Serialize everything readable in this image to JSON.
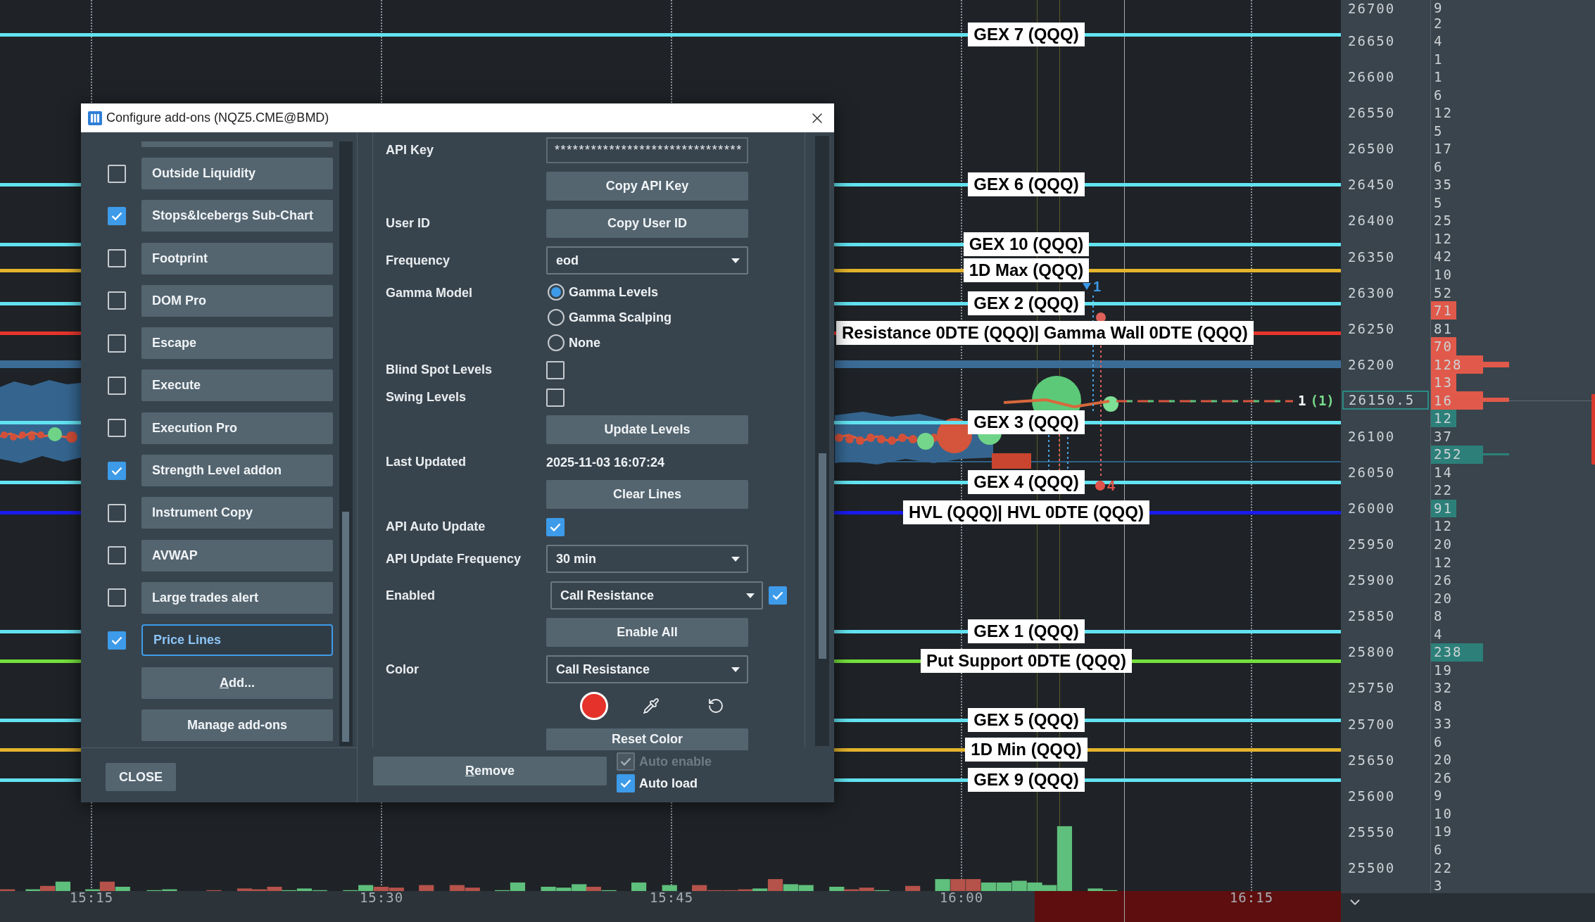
{
  "chart": {
    "levels": [
      {
        "label": "GEX 7 (QQQ)",
        "color": "#62e3f1"
      },
      {
        "label": "GEX 6 (QQQ)",
        "color": "#62e3f1"
      },
      {
        "label": "GEX 10 (QQQ)",
        "color": "#62e3f1"
      },
      {
        "label": "1D Max (QQQ)",
        "color": "#e4b42c"
      },
      {
        "label": "GEX 2 (QQQ)",
        "color": "#62e3f1"
      },
      {
        "label": "Resistance 0DTE (QQQ)| Gamma Wall 0DTE (QQQ)",
        "color": "#e8352c"
      },
      {
        "label": "GEX 3 (QQQ)",
        "color": "#62e3f1"
      },
      {
        "label": "GEX 4 (QQQ)",
        "color": "#62e3f1"
      },
      {
        "label": "HVL (QQQ)| HVL 0DTE (QQQ)",
        "color": "#1b1bf0"
      },
      {
        "label": "GEX 1 (QQQ)",
        "color": "#62e3f1"
      },
      {
        "label": "Put Support 0DTE (QQQ)",
        "color": "#74e03c"
      },
      {
        "label": "GEX 5 (QQQ)",
        "color": "#62e3f1"
      },
      {
        "label": "1D Min (QQQ)",
        "color": "#e4b42c"
      },
      {
        "label": "GEX 9 (QQQ)",
        "color": "#62e3f1"
      }
    ],
    "order_markers": [
      {
        "kind": "arrow",
        "text": "1",
        "color": "#3b9ae8"
      },
      {
        "kind": "dot",
        "text": "4",
        "color": "#e0524a"
      }
    ],
    "position_marker": {
      "count": "1",
      "detail": "(1)"
    },
    "time_axis": [
      "15:15",
      "15:30",
      "15:45",
      "16:00",
      "16:15"
    ]
  },
  "price_axis": {
    "ticks": [
      {
        "kind": "tick",
        "price": "26700"
      },
      {
        "kind": "tick",
        "price": "26650"
      },
      {
        "kind": "tick",
        "price": "26600"
      },
      {
        "kind": "tick",
        "price": "26550"
      },
      {
        "kind": "tick",
        "price": "26500"
      },
      {
        "kind": "tick",
        "price": "26450"
      },
      {
        "kind": "tick",
        "price": "26400"
      },
      {
        "kind": "tick",
        "price": "26350"
      },
      {
        "kind": "tick",
        "price": "26300"
      },
      {
        "kind": "tick",
        "price": "26250"
      },
      {
        "kind": "tick",
        "price": "26200"
      },
      {
        "kind": "current",
        "price": "26150.5"
      },
      {
        "kind": "tick",
        "price": "26100"
      },
      {
        "kind": "tick",
        "price": "26050"
      },
      {
        "kind": "tick",
        "price": "26000"
      },
      {
        "kind": "tick",
        "price": "25950"
      },
      {
        "kind": "tick",
        "price": "25900"
      },
      {
        "kind": "tick",
        "price": "25850"
      },
      {
        "kind": "tick",
        "price": "25800"
      },
      {
        "kind": "tick",
        "price": "25750"
      },
      {
        "kind": "tick",
        "price": "25700"
      },
      {
        "kind": "tick",
        "price": "25650"
      },
      {
        "kind": "tick",
        "price": "25600"
      },
      {
        "kind": "tick",
        "price": "25550"
      },
      {
        "kind": "tick",
        "price": "25500"
      }
    ],
    "volumes": [
      "9",
      "2",
      "4",
      "1",
      "1",
      "6",
      "12",
      "5",
      "17",
      "6",
      "35",
      "5",
      "25",
      "12",
      "42",
      "10",
      "52",
      "71",
      "81",
      "70",
      "128",
      "13",
      "16",
      "12",
      "37",
      "252",
      "14",
      "22",
      "91",
      "12",
      "20",
      "12",
      "26",
      "20",
      "8",
      "4",
      "238",
      "19",
      "32",
      "8",
      "33",
      "6",
      "20",
      "26",
      "9",
      "10",
      "19",
      "6",
      "22",
      "3"
    ]
  },
  "dialog": {
    "title": "Configure add-ons (NQZ5.CME@BMD)",
    "addons": [
      {
        "name": "Outside Liquidity",
        "checked": false,
        "selected": false
      },
      {
        "name": "Stops&Icebergs Sub-Chart",
        "checked": true,
        "selected": false
      },
      {
        "name": "Footprint",
        "checked": false,
        "selected": false
      },
      {
        "name": "DOM Pro",
        "checked": false,
        "selected": false
      },
      {
        "name": "Escape",
        "checked": false,
        "selected": false
      },
      {
        "name": "Execute",
        "checked": false,
        "selected": false
      },
      {
        "name": "Execution Pro",
        "checked": false,
        "selected": false
      },
      {
        "name": "Strength Level addon",
        "checked": true,
        "selected": false
      },
      {
        "name": "Instrument Copy",
        "checked": false,
        "selected": false
      },
      {
        "name": "AVWAP",
        "checked": false,
        "selected": false
      },
      {
        "name": "Large trades alert",
        "checked": false,
        "selected": false
      },
      {
        "name": "Price Lines",
        "checked": true,
        "selected": true
      }
    ],
    "addon_actions": [
      {
        "label": "Add...",
        "mnemonic": true
      },
      {
        "label": "Manage add-ons",
        "mnemonic": false
      }
    ],
    "close_button": "CLOSE",
    "settings": [
      {
        "kind": "password",
        "label": "API Key",
        "value": "*******************************"
      },
      {
        "kind": "button",
        "button": "Copy API Key"
      },
      {
        "kind": "button",
        "label": "User ID",
        "button": "Copy User ID"
      },
      {
        "kind": "dropdown",
        "label": "Frequency",
        "value": "eod"
      },
      {
        "kind": "radio",
        "label": "Gamma Model",
        "options": [
          {
            "label": "Gamma Levels",
            "selected": true
          },
          {
            "label": "Gamma Scalping",
            "selected": false
          },
          {
            "label": "None",
            "selected": false
          }
        ]
      },
      {
        "kind": "checkbox",
        "label": "Blind Spot Levels",
        "checked": false
      },
      {
        "kind": "checkbox",
        "label": "Swing Levels",
        "checked": false
      },
      {
        "kind": "button",
        "button": "Update Levels"
      },
      {
        "kind": "text",
        "label": "Last Updated",
        "value": "2025-11-03 16:07:24"
      },
      {
        "kind": "button",
        "button": "Clear Lines"
      },
      {
        "kind": "checkbox",
        "label": "API Auto Update",
        "checked": true
      },
      {
        "kind": "dropdown",
        "label": "API Update Frequency",
        "value": "30 min"
      },
      {
        "kind": "combo",
        "label": "Enabled",
        "value": "Call Resistance",
        "checked": true
      },
      {
        "kind": "button",
        "button": "Enable All"
      },
      {
        "kind": "dropdown",
        "label": "Color",
        "value": "Call Resistance"
      },
      {
        "kind": "color",
        "color": "#e5322a"
      },
      {
        "kind": "button",
        "button": "Reset Color"
      }
    ],
    "remove_button": {
      "label": "Remove",
      "mnemonic": true
    },
    "options": [
      {
        "label": "Auto enable",
        "checked": true,
        "disabled": true
      },
      {
        "label": "Auto load",
        "checked": true,
        "disabled": false
      }
    ]
  }
}
